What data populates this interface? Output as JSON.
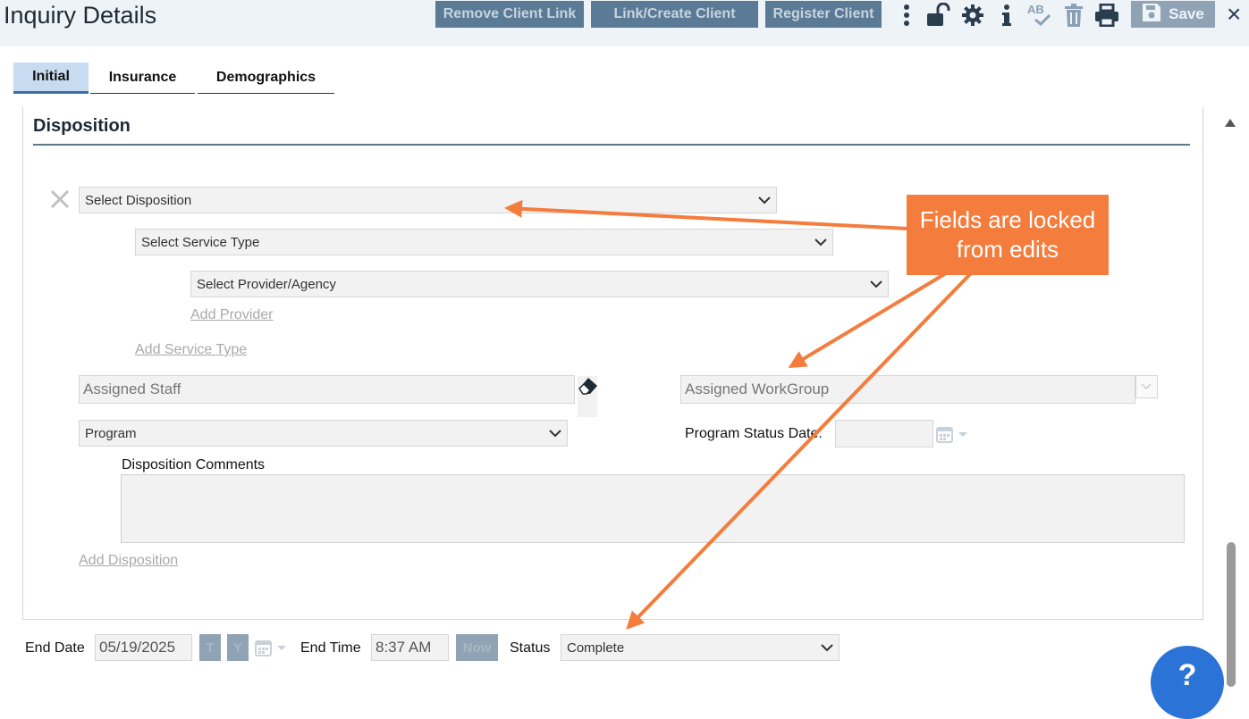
{
  "header": {
    "title": "Inquiry Details",
    "buttons": {
      "remove_client_link": "Remove Client Link",
      "link_create_client": "Link/Create Client",
      "register_client": "Register Client"
    },
    "icons": [
      "more-vertical-icon",
      "unlock-icon",
      "gear-icon",
      "info-icon",
      "spellcheck-icon",
      "trash-icon",
      "print-icon",
      "save-icon",
      "close-icon"
    ],
    "spellcheck_label": "AB",
    "save_label": "Save",
    "close_label": "×"
  },
  "tabs": [
    {
      "label": "Initial",
      "active": true
    },
    {
      "label": "Insurance",
      "active": false
    },
    {
      "label": "Demographics",
      "active": false
    }
  ],
  "disposition": {
    "section_title": "Disposition",
    "select_disposition": "Select Disposition",
    "select_service_type": "Select Service Type",
    "select_provider": "Select Provider/Agency",
    "add_provider": "Add Provider",
    "add_service_type": "Add Service Type",
    "assigned_staff_placeholder": "Assigned Staff",
    "assigned_workgroup_placeholder": "Assigned WorkGroup",
    "program": "Program",
    "program_status_date_label": "Program Status Date:",
    "program_status_date_value": "",
    "comments_label": "Disposition Comments",
    "comments_value": "",
    "add_disposition": "Add Disposition"
  },
  "footer": {
    "end_date_label": "End Date",
    "end_date_value": "05/19/2025",
    "t_button": "T",
    "y_button": "Y",
    "end_time_label": "End Time",
    "end_time_value": "8:37 AM",
    "now_button": "Now",
    "status_label": "Status",
    "status_value": "Complete"
  },
  "callout": {
    "line1": "Fields are locked",
    "line2": "from edits"
  },
  "help_label": "?",
  "colors": {
    "header_bg": "#eef3f8",
    "button_disabled": "#5a7a96",
    "callout": "#f47c3c",
    "tab_active": "#c7dcf0",
    "help_button": "#2b73d6"
  }
}
